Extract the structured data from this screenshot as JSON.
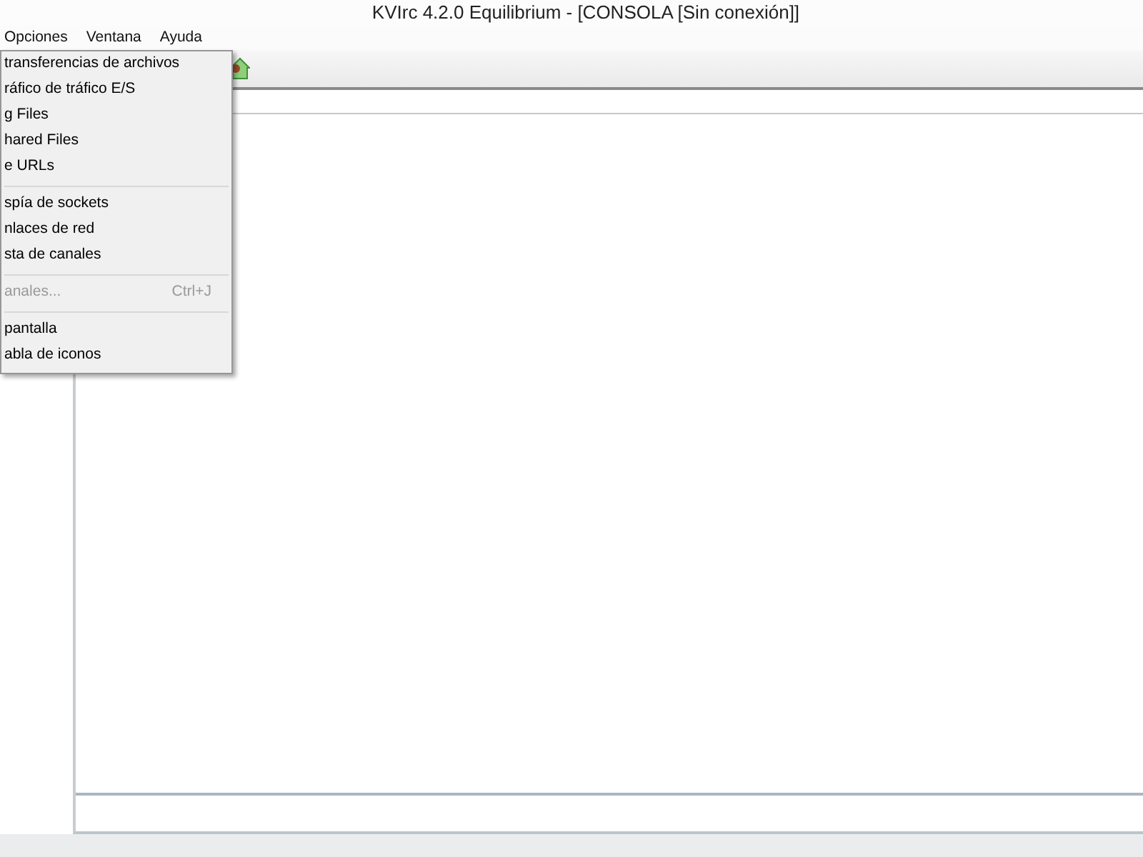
{
  "window": {
    "title": "KVIrc 4.2.0 Equilibrium - [CONSOLA [Sin conexión]]"
  },
  "menu_bar": [
    {
      "label": "Opciones"
    },
    {
      "label": "Ventana"
    },
    {
      "label": "Ayuda"
    }
  ],
  "dropdown_menu": {
    "items": [
      {
        "kind": "item",
        "label": "transferencias de archivos",
        "disabled": false
      },
      {
        "kind": "item",
        "label": "ráfico de tráfico E/S",
        "disabled": false
      },
      {
        "kind": "item",
        "label": "g Files",
        "disabled": false
      },
      {
        "kind": "item",
        "label": "hared Files",
        "disabled": false
      },
      {
        "kind": "item",
        "label": "e URLs",
        "disabled": false
      },
      {
        "kind": "separator"
      },
      {
        "kind": "item",
        "label": "spía de sockets",
        "disabled": false
      },
      {
        "kind": "item",
        "label": "nlaces de red",
        "disabled": false
      },
      {
        "kind": "item",
        "label": "sta de canales",
        "disabled": false
      },
      {
        "kind": "separator"
      },
      {
        "kind": "item",
        "label": "anales...",
        "shortcut": "Ctrl+J",
        "disabled": true
      },
      {
        "kind": "separator"
      },
      {
        "kind": "item",
        "label": "pantalla",
        "disabled": false
      },
      {
        "kind": "item",
        "label": "abla de iconos",
        "disabled": false
      }
    ]
  }
}
